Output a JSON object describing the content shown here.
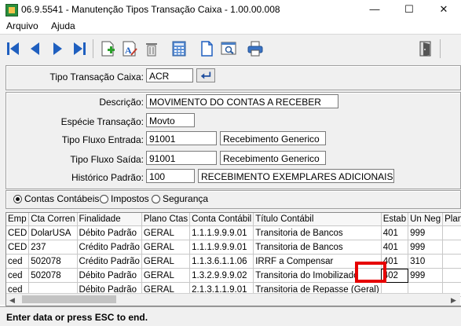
{
  "window": {
    "title": "06.9.5541 - Manutenção Tipos Transação Caixa - 1.00.00.008",
    "minimize": "—",
    "maximize": "☐",
    "close": "✕"
  },
  "menu": {
    "arquivo": "Arquivo",
    "ajuda": "Ajuda"
  },
  "toolbar_icons": [
    "first-icon",
    "prev-icon",
    "next-icon",
    "last-icon",
    "add-icon",
    "edit-icon",
    "delete-icon",
    "calculator-icon",
    "copy-icon",
    "search-icon",
    "print-icon",
    "exit-icon"
  ],
  "header": {
    "tipo_label": "Tipo Transação Caixa:",
    "tipo_value": "ACR"
  },
  "form": {
    "descricao_label": "Descrição:",
    "descricao_value": "MOVIMENTO DO CONTAS A RECEBER",
    "especie_label": "Espécie Transação:",
    "especie_value": "Movto",
    "entrada_label": "Tipo Fluxo Entrada:",
    "entrada_code": "91001",
    "entrada_desc": "Recebimento Generico",
    "saida_label": "Tipo Fluxo Saída:",
    "saida_code": "91001",
    "saida_desc": "Recebimento Generico",
    "historico_label": "Histórico Padrão:",
    "historico_code": "100",
    "historico_desc": "RECEBIMENTO EXEMPLARES ADICIONAIS"
  },
  "tabs": {
    "contas": "Contas Contábeis",
    "impostos": "Impostos",
    "seguranca": "Segurança"
  },
  "grid": {
    "headers": [
      "Emp",
      "Cta Corren",
      "Finalidade",
      "Plano Ctas",
      "Conta Contábil",
      "Título Contábil",
      "Estab",
      "Un Neg",
      "Plano"
    ],
    "rows": [
      [
        "CED",
        "DolarUSA",
        "Débito Padrão",
        "GERAL",
        "1.1.1.9.9.9.01",
        "Transitoria de Bancos",
        "401",
        "999",
        ""
      ],
      [
        "CED",
        "237",
        "Crédito Padrão",
        "GERAL",
        "1.1.1.9.9.9.01",
        "Transitoria de Bancos",
        "401",
        "999",
        ""
      ],
      [
        "ced",
        "502078",
        "Crédito Padrão",
        "GERAL",
        "1.1.3.6.1.1.06",
        "IRRF a Compensar",
        "401",
        "310",
        ""
      ],
      [
        "ced",
        "502078",
        "Débito Padrão",
        "GERAL",
        "1.3.2.9.9.9.02",
        "Transitoria do Imobilizado",
        "402",
        "999",
        ""
      ],
      [
        "ced",
        "",
        "Débito Padrão",
        "GERAL",
        "2.1.3.1.1.9.01",
        "Transitoria de Repasse (Geral)",
        "",
        "",
        ""
      ]
    ]
  },
  "status": "Enter data or press ESC to end.",
  "colors": {
    "highlight": "#e60000",
    "nav_blue": "#1f5fbf"
  }
}
